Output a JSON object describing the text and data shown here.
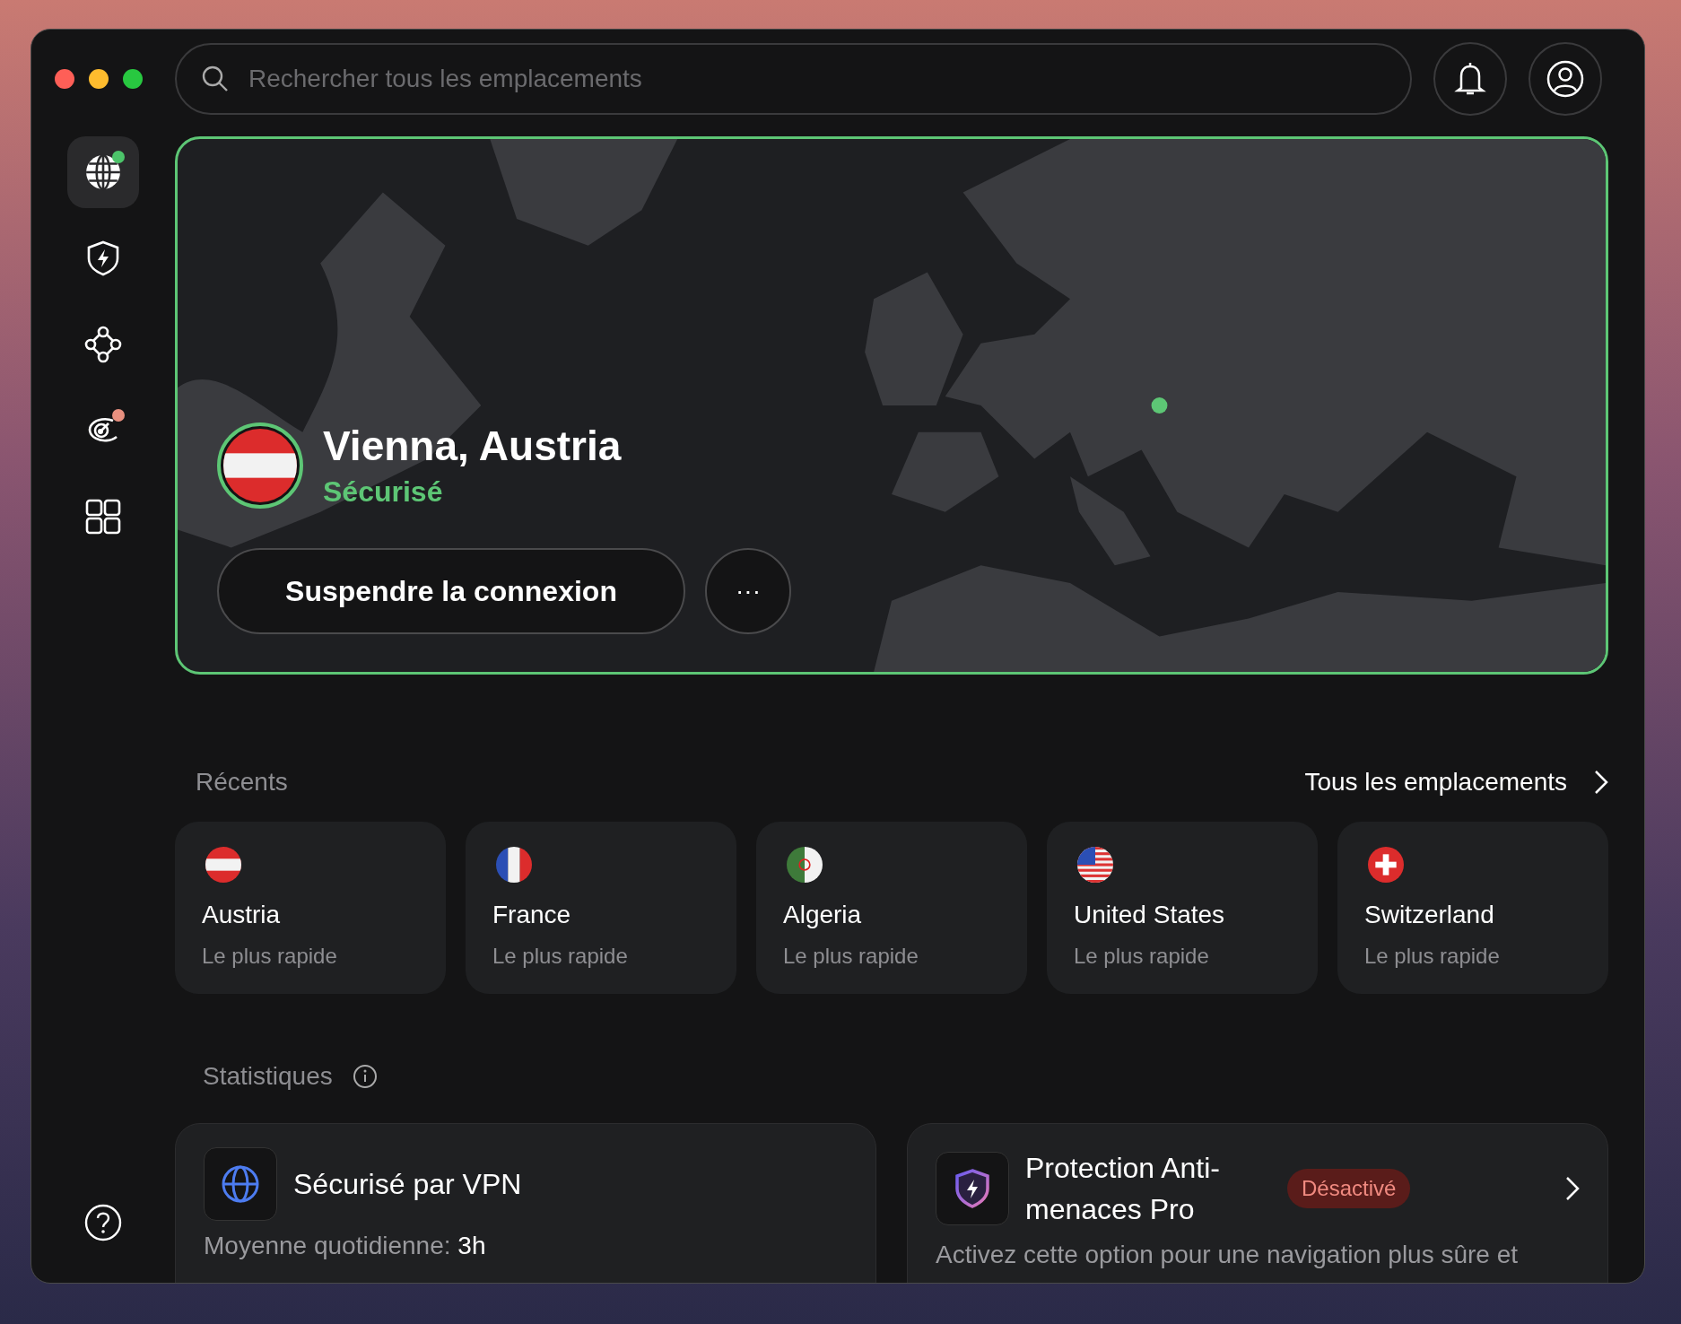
{
  "search": {
    "placeholder": "Rechercher tous les emplacements"
  },
  "sidebar": {
    "items": [
      {
        "kind": "globe",
        "selected": true,
        "color": "#4cc46a"
      },
      {
        "kind": "shield",
        "selected": false
      },
      {
        "kind": "nodes",
        "selected": false
      },
      {
        "kind": "radar",
        "selected": false,
        "color": "#e8907f"
      },
      {
        "kind": "grid",
        "selected": false
      }
    ]
  },
  "connection": {
    "location": "Vienna, Austria",
    "status": "Sécurisé",
    "kind": "austria",
    "button": "Suspendre la connexion",
    "more": "···"
  },
  "recents": {
    "title": "Récents",
    "link": "Tous les emplacements",
    "items": [
      {
        "kind": "austria",
        "name": "Austria",
        "sub": "Le plus rapide"
      },
      {
        "kind": "france",
        "name": "France",
        "sub": "Le plus rapide"
      },
      {
        "kind": "algeria",
        "name": "Algeria",
        "sub": "Le plus rapide"
      },
      {
        "kind": "usa",
        "name": "United States",
        "sub": "Le plus rapide"
      },
      {
        "kind": "switzerland",
        "name": "Switzerland",
        "sub": "Le plus rapide"
      }
    ]
  },
  "statistics": {
    "title": "Statistiques",
    "cards": [
      {
        "kind": "vpn",
        "title": "Sécurisé par VPN",
        "text": "Moyenne quotidienne: **3h**"
      },
      {
        "kind": "threat",
        "title": "Protection Anti-menaces Pro",
        "badge": "Désactivé",
        "text": "Activez cette option pour une navigation plus sûre et"
      }
    ]
  }
}
